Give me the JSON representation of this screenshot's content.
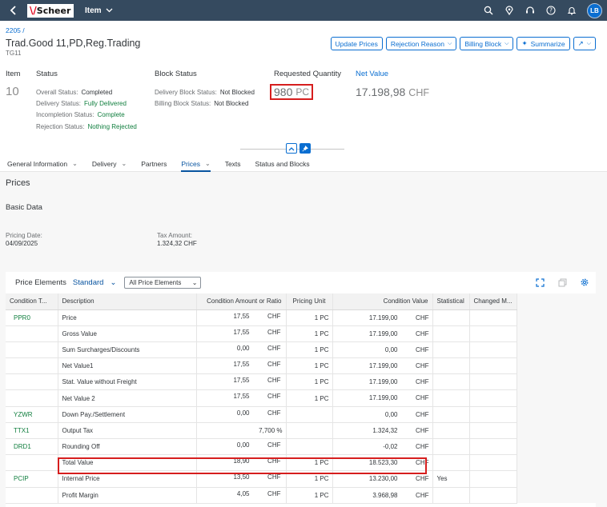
{
  "shell": {
    "logo_mark": "\\/",
    "logo_text": "Scheer",
    "app_title": "Item",
    "avatar": "LB"
  },
  "header": {
    "breadcrumb": "2205 /",
    "title": "Trad.Good 11,PD,Reg.Trading",
    "subtitle": "TG11",
    "actions": {
      "update_prices": "Update Prices",
      "rejection_reason": "Rejection Reason",
      "billing_block": "Billing Block",
      "summarize": "Summarize"
    },
    "item_label": "Item",
    "item_number": "10",
    "status": {
      "title": "Status",
      "overall_label": "Overall Status:",
      "overall_value": "Completed",
      "delivery_label": "Delivery Status:",
      "delivery_value": "Fully Delivered",
      "incompletion_label": "Incompletion Status:",
      "incompletion_value": "Complete",
      "rejection_label": "Rejection Status:",
      "rejection_value": "Nothing Rejected"
    },
    "block_status": {
      "title": "Block Status",
      "delivery_block_label": "Delivery Block Status:",
      "delivery_block_value": "Not Blocked",
      "billing_block_label": "Billing Block Status:",
      "billing_block_value": "Not Blocked"
    },
    "requested_quantity": {
      "title": "Requested Quantity",
      "value": "980",
      "unit": "PC"
    },
    "net_value": {
      "title": "Net Value",
      "value": "17.198,98",
      "currency": "CHF"
    }
  },
  "tabs": [
    {
      "label": "General Information",
      "has_menu": true
    },
    {
      "label": "Delivery",
      "has_menu": true
    },
    {
      "label": "Partners",
      "has_menu": false
    },
    {
      "label": "Prices",
      "has_menu": true,
      "active": true
    },
    {
      "label": "Texts",
      "has_menu": false
    },
    {
      "label": "Status and Blocks",
      "has_menu": false
    }
  ],
  "prices": {
    "section_title": "Prices",
    "subsection_title": "Basic Data",
    "pricing_date_label": "Pricing Date:",
    "pricing_date_value": "04/09/2025",
    "tax_amount_label": "Tax Amount:",
    "tax_amount_value": "1.324,32 CHF"
  },
  "table": {
    "title": "Price Elements",
    "variant": "Standard",
    "filter": "All Price Elements",
    "columns": [
      "Condition T...",
      "Description",
      "Condition Amount or Ratio",
      "Pricing Unit",
      "Condition Value",
      "Statistical",
      "Changed M..."
    ],
    "rows": [
      {
        "type": "PPR0",
        "description": "Price",
        "amount": "17,55",
        "amount_cur": "CHF",
        "ratio": "",
        "unit": "1 PC",
        "value": "17.199,00",
        "value_cur": "CHF",
        "statistical": "",
        "changed": ""
      },
      {
        "type": "",
        "description": "Gross Value",
        "amount": "17,55",
        "amount_cur": "CHF",
        "ratio": "",
        "unit": "1 PC",
        "value": "17.199,00",
        "value_cur": "CHF",
        "statistical": "",
        "changed": ""
      },
      {
        "type": "",
        "description": "Sum Surcharges/Discounts",
        "amount": "0,00",
        "amount_cur": "CHF",
        "ratio": "",
        "unit": "1 PC",
        "value": "0,00",
        "value_cur": "CHF",
        "statistical": "",
        "changed": ""
      },
      {
        "type": "",
        "description": "Net Value1",
        "amount": "17,55",
        "amount_cur": "CHF",
        "ratio": "",
        "unit": "1 PC",
        "value": "17.199,00",
        "value_cur": "CHF",
        "statistical": "",
        "changed": ""
      },
      {
        "type": "",
        "description": "Stat. Value without Freight",
        "amount": "17,55",
        "amount_cur": "CHF",
        "ratio": "",
        "unit": "1 PC",
        "value": "17.199,00",
        "value_cur": "CHF",
        "statistical": "",
        "changed": ""
      },
      {
        "type": "",
        "description": "Net Value 2",
        "amount": "17,55",
        "amount_cur": "CHF",
        "ratio": "",
        "unit": "1 PC",
        "value": "17.199,00",
        "value_cur": "CHF",
        "statistical": "",
        "changed": ""
      },
      {
        "type": "YZWR",
        "description": "Down Pay./Settlement",
        "amount": "0,00",
        "amount_cur": "CHF",
        "ratio": "",
        "unit": "",
        "value": "0,00",
        "value_cur": "CHF",
        "statistical": "",
        "changed": ""
      },
      {
        "type": "TTX1",
        "description": "Output Tax",
        "amount": "",
        "amount_cur": "",
        "ratio": "7,700 %",
        "unit": "",
        "value": "1.324,32",
        "value_cur": "CHF",
        "statistical": "",
        "changed": ""
      },
      {
        "type": "DRD1",
        "description": "Rounding Off",
        "amount": "0,00",
        "amount_cur": "CHF",
        "ratio": "",
        "unit": "",
        "value": "-0,02",
        "value_cur": "CHF",
        "statistical": "",
        "changed": ""
      },
      {
        "type": "",
        "description": "Total Value",
        "amount": "18,90",
        "amount_cur": "CHF",
        "ratio": "",
        "unit": "1 PC",
        "value": "18.523,30",
        "value_cur": "CHF",
        "statistical": "",
        "changed": ""
      },
      {
        "type": "PCIP",
        "description": "Internal Price",
        "amount": "13,50",
        "amount_cur": "CHF",
        "ratio": "",
        "unit": "1 PC",
        "value": "13.230,00",
        "value_cur": "CHF",
        "statistical": "Yes",
        "changed": ""
      },
      {
        "type": "",
        "description": "Profit Margin",
        "amount": "4,05",
        "amount_cur": "CHF",
        "ratio": "",
        "unit": "1 PC",
        "value": "3.968,98",
        "value_cur": "CHF",
        "statistical": "",
        "changed": ""
      }
    ]
  },
  "colors": {
    "shell": "#354a5f",
    "accent": "#0a6ed1",
    "positive": "#107e3e",
    "highlight": "#d61e1e"
  },
  "icons": [
    "back-icon",
    "chevron-down-icon",
    "search-icon",
    "location-icon",
    "help-icon",
    "notification-icon",
    "sparkle-icon",
    "share-icon",
    "collapse-icon",
    "pin-icon",
    "fullscreen-icon",
    "copy-icon",
    "settings-icon"
  ]
}
